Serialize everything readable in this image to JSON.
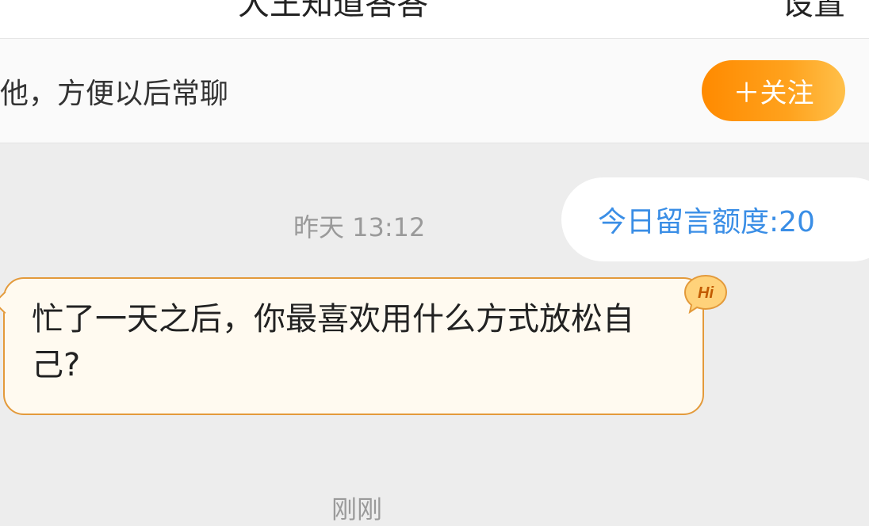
{
  "header": {
    "title": "大王知道答答",
    "settings_label": "设置"
  },
  "follow_bar": {
    "tip_text": "他，方便以后常聊",
    "follow_button": "＋关注"
  },
  "chat": {
    "quota_label": "今日留言额度:20",
    "messages": [
      {
        "time": "昨天 13:12"
      },
      {
        "text": "忙了一天之后，你最喜欢用什么方式放松自己?"
      },
      {
        "time": "刚刚"
      }
    ],
    "badge": "Hi"
  }
}
